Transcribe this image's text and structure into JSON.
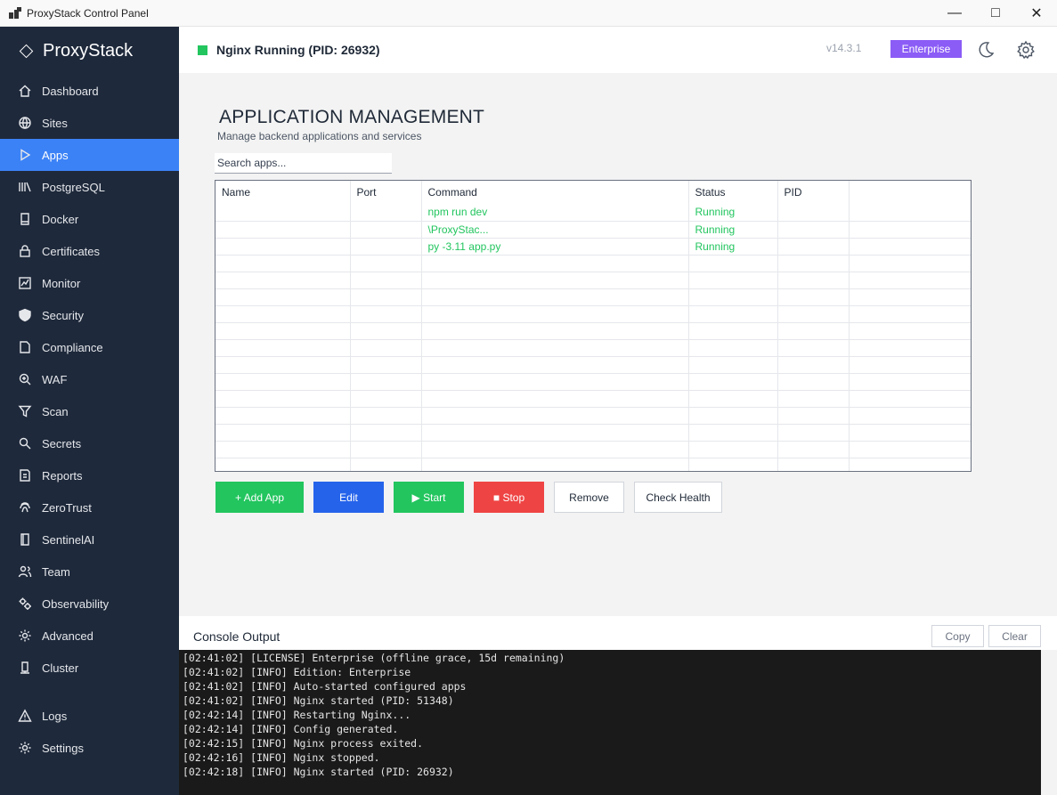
{
  "window": {
    "title": "ProxyStack Control Panel"
  },
  "sidebar": {
    "brand": "ProxyStack",
    "items": [
      {
        "label": "Dashboard",
        "icon": "home-icon"
      },
      {
        "label": "Sites",
        "icon": "globe-icon"
      },
      {
        "label": "Apps",
        "icon": "play-icon",
        "active": true
      },
      {
        "label": "PostgreSQL",
        "icon": "database-icon"
      },
      {
        "label": "Docker",
        "icon": "container-icon"
      },
      {
        "label": "Certificates",
        "icon": "lock-icon"
      },
      {
        "label": "Monitor",
        "icon": "chart-icon"
      },
      {
        "label": "Security",
        "icon": "shield-icon"
      },
      {
        "label": "Compliance",
        "icon": "document-icon"
      },
      {
        "label": "WAF",
        "icon": "zoom-icon"
      },
      {
        "label": "Scan",
        "icon": "filter-icon"
      },
      {
        "label": "Secrets",
        "icon": "key-search-icon"
      },
      {
        "label": "Reports",
        "icon": "report-icon"
      },
      {
        "label": "ZeroTrust",
        "icon": "fingerprint-icon"
      },
      {
        "label": "SentinelAI",
        "icon": "notebook-icon"
      },
      {
        "label": "Team",
        "icon": "people-icon"
      },
      {
        "label": "Observability",
        "icon": "gears-icon"
      },
      {
        "label": "Advanced",
        "icon": "gear-icon"
      },
      {
        "label": "Cluster",
        "icon": "server-icon"
      }
    ],
    "bottom_items": [
      {
        "label": "Logs",
        "icon": "warning-icon"
      },
      {
        "label": "Settings",
        "icon": "gear-icon"
      }
    ]
  },
  "header": {
    "status": "Nginx Running (PID: 26932)",
    "status_color": "#22c55e",
    "version": "v14.3.1",
    "edition": "Enterprise"
  },
  "main": {
    "title": "APPLICATION MANAGEMENT",
    "subtitle": "Manage backend applications and services",
    "search_placeholder": "Search apps...",
    "columns": [
      "Name",
      "Port",
      "Command",
      "Status",
      "PID",
      ""
    ],
    "rows": [
      {
        "name": "",
        "port": "",
        "command": "npm run dev",
        "status": "Running",
        "pid": ""
      },
      {
        "name": "",
        "port": "",
        "command": "\\ProxyStac...",
        "status": "Running",
        "pid": ""
      },
      {
        "name": "",
        "port": "",
        "command": "py -3.11 app.py",
        "status": "Running",
        "pid": ""
      }
    ],
    "buttons": {
      "add": "+ Add App",
      "edit": "Edit",
      "start": "▶ Start",
      "stop": "■ Stop",
      "remove": "Remove",
      "health": "Check Health"
    }
  },
  "console": {
    "title": "Console Output",
    "copy": "Copy",
    "clear": "Clear",
    "lines": [
      "[02:41:02] [LICENSE] Enterprise (offline grace, 15d remaining)",
      "[02:41:02] [INFO] Edition: Enterprise",
      "[02:41:02] [INFO] Auto-started configured apps",
      "[02:41:02] [INFO] Nginx started (PID: 51348)",
      "[02:42:14] [INFO] Restarting Nginx...",
      "[02:42:14] [INFO] Config generated.",
      "[02:42:15] [INFO] Nginx process exited.",
      "[02:42:16] [INFO] Nginx stopped.",
      "[02:42:18] [INFO] Nginx started (PID: 26932)"
    ]
  }
}
